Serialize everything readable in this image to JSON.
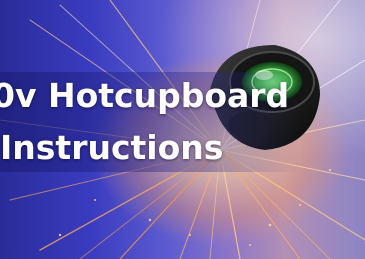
{
  "banner": {
    "line1": "0v Hotcupboard",
    "line2": "Instructions"
  },
  "colors": {
    "background_deep": "#2a2c9a",
    "spark_orange": "#ffb060",
    "lens_green": "#3fae45"
  },
  "image": {
    "subject": "lamp-with-sparks",
    "icon": "lamp-icon"
  }
}
